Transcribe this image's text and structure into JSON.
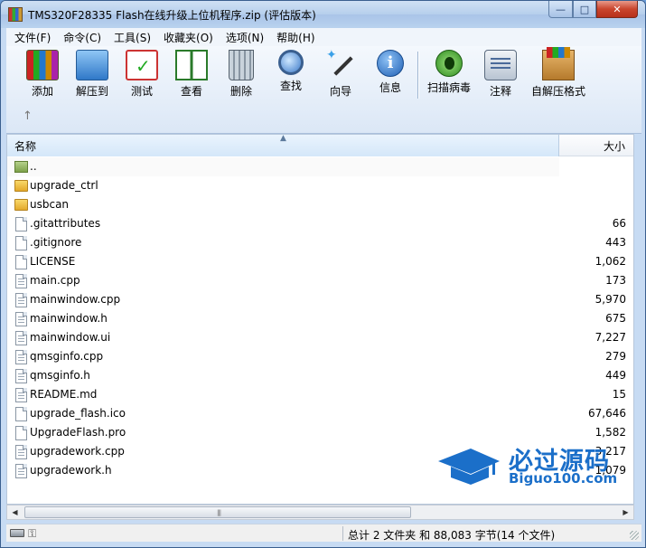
{
  "window": {
    "title": "TMS320F28335 Flash在线升级上位机程序.zip (评估版本)",
    "controls": {
      "minimize": "—",
      "maximize": "□",
      "close": "✕"
    }
  },
  "menu": [
    "文件(F)",
    "命令(C)",
    "工具(S)",
    "收藏夹(O)",
    "选项(N)",
    "帮助(H)"
  ],
  "toolbar": {
    "add": "添加",
    "extract": "解压到",
    "test": "测试",
    "view": "查看",
    "delete": "删除",
    "find": "查找",
    "wizard": "向导",
    "info": "信息",
    "scan": "扫描病毒",
    "comment": "注释",
    "sfx": "自解压格式",
    "up_arrow": "↑"
  },
  "list": {
    "col_name": "名称",
    "col_size": "大小",
    "sort_indicator": "▲",
    "rows": [
      {
        "name": "..",
        "size": "",
        "type": "parent"
      },
      {
        "name": "upgrade_ctrl",
        "size": "",
        "type": "folder"
      },
      {
        "name": "usbcan",
        "size": "",
        "type": "folder"
      },
      {
        "name": ".gitattributes",
        "size": "66",
        "type": "file"
      },
      {
        "name": ".gitignore",
        "size": "443",
        "type": "file"
      },
      {
        "name": "LICENSE",
        "size": "1,062",
        "type": "file"
      },
      {
        "name": "main.cpp",
        "size": "173",
        "type": "text"
      },
      {
        "name": "mainwindow.cpp",
        "size": "5,970",
        "type": "text"
      },
      {
        "name": "mainwindow.h",
        "size": "675",
        "type": "text"
      },
      {
        "name": "mainwindow.ui",
        "size": "7,227",
        "type": "text"
      },
      {
        "name": "qmsginfo.cpp",
        "size": "279",
        "type": "text"
      },
      {
        "name": "qmsginfo.h",
        "size": "449",
        "type": "text"
      },
      {
        "name": "README.md",
        "size": "15",
        "type": "text"
      },
      {
        "name": "upgrade_flash.ico",
        "size": "67,646",
        "type": "file"
      },
      {
        "name": "UpgradeFlash.pro",
        "size": "1,582",
        "type": "file"
      },
      {
        "name": "upgradework.cpp",
        "size": "3,217",
        "type": "text"
      },
      {
        "name": "upgradework.h",
        "size": "1,079",
        "type": "text"
      }
    ]
  },
  "scrollbar": {
    "left": "◀",
    "right": "▶",
    "grip": "|||"
  },
  "status": {
    "summary": "总计 2 文件夹 和 88,083 字节(14 个文件)",
    "key": "⚿"
  },
  "watermark": {
    "cn": "必过源码",
    "en": "Biguo100.com"
  },
  "colors": {
    "accent": "#1b6fc9",
    "titlebar": "#b6cfec"
  }
}
